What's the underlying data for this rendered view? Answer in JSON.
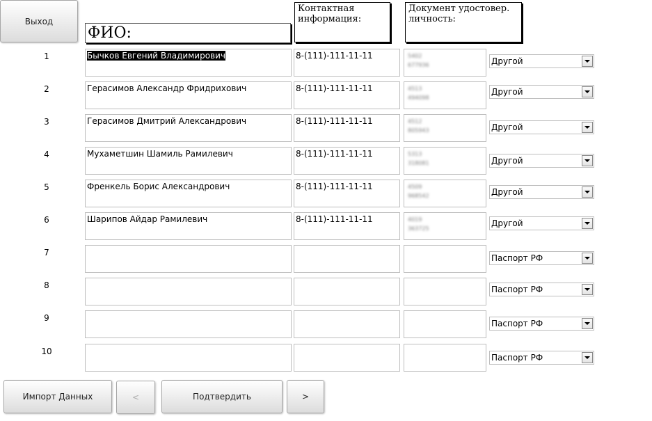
{
  "toolbar": {
    "exit_label": "Выход"
  },
  "headers": {
    "fio": "ФИО:",
    "contact": "Контактная информация:",
    "document": "Документ удостовер. личность:"
  },
  "rows": [
    {
      "num": "1",
      "fio": "Бычков Евгений Владимирович",
      "contact": "8-(111)-111-11-11",
      "doc_series": "5402",
      "doc_number": "677936",
      "doc_type": "Другой"
    },
    {
      "num": "2",
      "fio": "Герасимов Александр Фридрихович",
      "contact": "8-(111)-111-11-11",
      "doc_series": "4513",
      "doc_number": "494098",
      "doc_type": "Другой"
    },
    {
      "num": "3",
      "fio": "Герасимов Дмитрий Александрович",
      "contact": "8-(111)-111-11-11",
      "doc_series": "4512",
      "doc_number": "805943",
      "doc_type": "Другой"
    },
    {
      "num": "4",
      "fio": "Мухаметшин Шамиль Рамилевич",
      "contact": "8-(111)-111-11-11",
      "doc_series": "5313",
      "doc_number": "318081",
      "doc_type": "Другой"
    },
    {
      "num": "5",
      "fio": "Френкель Борис Александрович",
      "contact": "8-(111)-111-11-11",
      "doc_series": "4509",
      "doc_number": "968542",
      "doc_type": "Другой"
    },
    {
      "num": "6",
      "fio": "Шарипов Айдар Рамилевич",
      "contact": "8-(111)-111-11-11",
      "doc_series": "4019",
      "doc_number": "363725",
      "doc_type": "Другой"
    },
    {
      "num": "7",
      "fio": "",
      "contact": "",
      "doc_series": "",
      "doc_number": "",
      "doc_type": "Паспорт РФ"
    },
    {
      "num": "8",
      "fio": "",
      "contact": "",
      "doc_series": "",
      "doc_number": "",
      "doc_type": "Паспорт РФ"
    },
    {
      "num": "9",
      "fio": "",
      "contact": "",
      "doc_series": "",
      "doc_number": "",
      "doc_type": "Паспорт РФ"
    },
    {
      "num": "10",
      "fio": "",
      "contact": "",
      "doc_series": "",
      "doc_number": "",
      "doc_type": "Паспорт РФ"
    }
  ],
  "footer": {
    "import_label": "Импорт Данных",
    "prev_label": "<",
    "confirm_label": "Подтвердить",
    "next_label": ">"
  }
}
